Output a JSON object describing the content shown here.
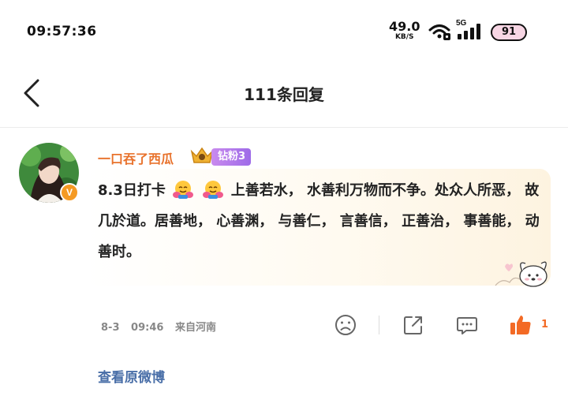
{
  "status_bar": {
    "time": "09:57:36",
    "net_speed": "49.0",
    "net_unit": "KB/S",
    "network": "5G",
    "battery": "91"
  },
  "nav": {
    "title": "111条回复",
    "back_icon": "chevron-left-icon"
  },
  "comment": {
    "username": "一口吞了西瓜",
    "fan_badge": "钻粉3",
    "verified_label": "V",
    "text_part1": "8.3日打卡",
    "text_part2": "上善若水， 水善利万物而不争。处众人所恶， 故几於道。居善地， 心善渊， 与善仁， 言善信， 正善治， 事善能， 动善时。",
    "date": "8-3",
    "time": "09:46",
    "location": "来自河南",
    "like_count": "1",
    "colors": {
      "username": "#e8722c",
      "like": "#f36a25",
      "link": "#4a6fa8",
      "fan_badge": "#a86ce8"
    }
  },
  "actions": {
    "icons": [
      "frown-icon",
      "share-icon",
      "comment-icon",
      "thumbs-up-icon"
    ]
  },
  "footer": {
    "view_original": "查看原微博"
  }
}
